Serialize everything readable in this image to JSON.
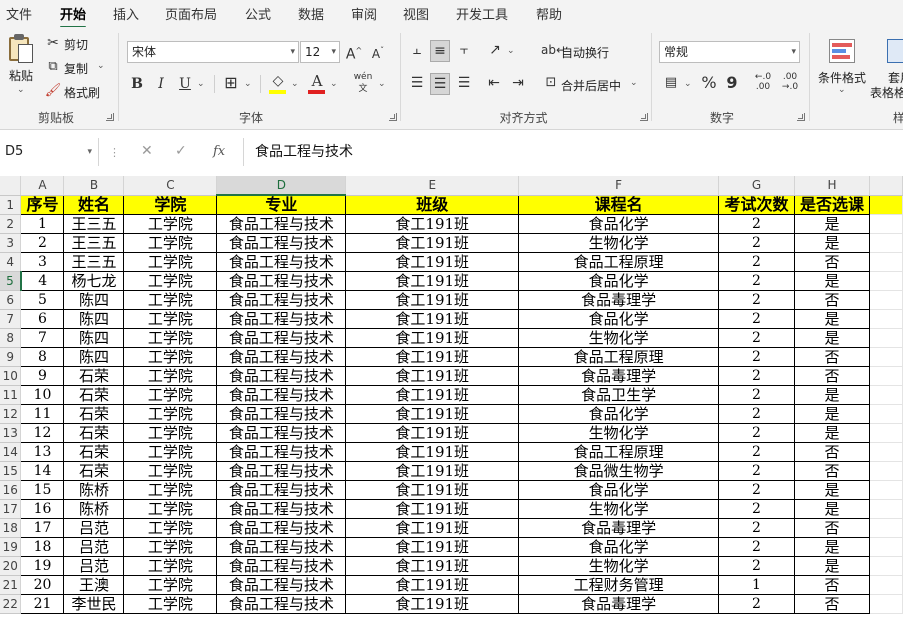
{
  "tabs": [
    "文件",
    "开始",
    "插入",
    "页面布局",
    "公式",
    "数据",
    "审阅",
    "视图",
    "开发工具",
    "帮助"
  ],
  "active_tab": "开始",
  "clipboard": {
    "paste": "粘贴",
    "cut": "剪切",
    "copy": "复制",
    "format_painter": "格式刷",
    "group": "剪贴板"
  },
  "font": {
    "name": "宋体",
    "size": "12",
    "bold": "B",
    "italic": "I",
    "underline": "U",
    "group": "字体"
  },
  "alignment": {
    "wrap": "自动换行",
    "merge": "合并后居中",
    "group": "对齐方式"
  },
  "number": {
    "format": "常规",
    "percent": "%",
    "comma": "9",
    "group": "数字"
  },
  "styles": {
    "conditional": "条件格式",
    "table_format_1": "套用",
    "table_format_2": "表格格",
    "group_partial": "样"
  },
  "formula_bar": {
    "name_box": "D5",
    "fx": "fx",
    "content": "食品工程与技术"
  },
  "sheet": {
    "columns": [
      "A",
      "B",
      "C",
      "D",
      "E",
      "F",
      "G",
      "H"
    ],
    "selected_column": "D",
    "selected_row": "5",
    "headers": [
      "序号",
      "姓名",
      "学院",
      "专业",
      "班级",
      "课程名",
      "考试次数",
      "是否选课"
    ],
    "rows": [
      [
        "1",
        "王三五",
        "工学院",
        "食品工程与技术",
        "食工191班",
        "食品化学",
        "2",
        "是"
      ],
      [
        "2",
        "王三五",
        "工学院",
        "食品工程与技术",
        "食工191班",
        "生物化学",
        "2",
        "是"
      ],
      [
        "3",
        "王三五",
        "工学院",
        "食品工程与技术",
        "食工191班",
        "食品工程原理",
        "2",
        "否"
      ],
      [
        "4",
        "杨七龙",
        "工学院",
        "食品工程与技术",
        "食工191班",
        "食品化学",
        "2",
        "是"
      ],
      [
        "5",
        "陈四",
        "工学院",
        "食品工程与技术",
        "食工191班",
        "食品毒理学",
        "2",
        "否"
      ],
      [
        "6",
        "陈四",
        "工学院",
        "食品工程与技术",
        "食工191班",
        "食品化学",
        "2",
        "是"
      ],
      [
        "7",
        "陈四",
        "工学院",
        "食品工程与技术",
        "食工191班",
        "生物化学",
        "2",
        "是"
      ],
      [
        "8",
        "陈四",
        "工学院",
        "食品工程与技术",
        "食工191班",
        "食品工程原理",
        "2",
        "否"
      ],
      [
        "9",
        "石荣",
        "工学院",
        "食品工程与技术",
        "食工191班",
        "食品毒理学",
        "2",
        "否"
      ],
      [
        "10",
        "石荣",
        "工学院",
        "食品工程与技术",
        "食工191班",
        "食品卫生学",
        "2",
        "是"
      ],
      [
        "11",
        "石荣",
        "工学院",
        "食品工程与技术",
        "食工191班",
        "食品化学",
        "2",
        "是"
      ],
      [
        "12",
        "石荣",
        "工学院",
        "食品工程与技术",
        "食工191班",
        "生物化学",
        "2",
        "是"
      ],
      [
        "13",
        "石荣",
        "工学院",
        "食品工程与技术",
        "食工191班",
        "食品工程原理",
        "2",
        "否"
      ],
      [
        "14",
        "石荣",
        "工学院",
        "食品工程与技术",
        "食工191班",
        "食品微生物学",
        "2",
        "否"
      ],
      [
        "15",
        "陈桥",
        "工学院",
        "食品工程与技术",
        "食工191班",
        "食品化学",
        "2",
        "是"
      ],
      [
        "16",
        "陈桥",
        "工学院",
        "食品工程与技术",
        "食工191班",
        "生物化学",
        "2",
        "是"
      ],
      [
        "17",
        "吕范",
        "工学院",
        "食品工程与技术",
        "食工191班",
        "食品毒理学",
        "2",
        "否"
      ],
      [
        "18",
        "吕范",
        "工学院",
        "食品工程与技术",
        "食工191班",
        "食品化学",
        "2",
        "是"
      ],
      [
        "19",
        "吕范",
        "工学院",
        "食品工程与技术",
        "食工191班",
        "生物化学",
        "2",
        "是"
      ],
      [
        "20",
        "王澳",
        "工学院",
        "食品工程与技术",
        "食工191班",
        "工程财务管理",
        "1",
        "否"
      ],
      [
        "21",
        "李世民",
        "工学院",
        "食品工程与技术",
        "食工191班",
        "食品毒理学",
        "2",
        "否"
      ]
    ]
  }
}
